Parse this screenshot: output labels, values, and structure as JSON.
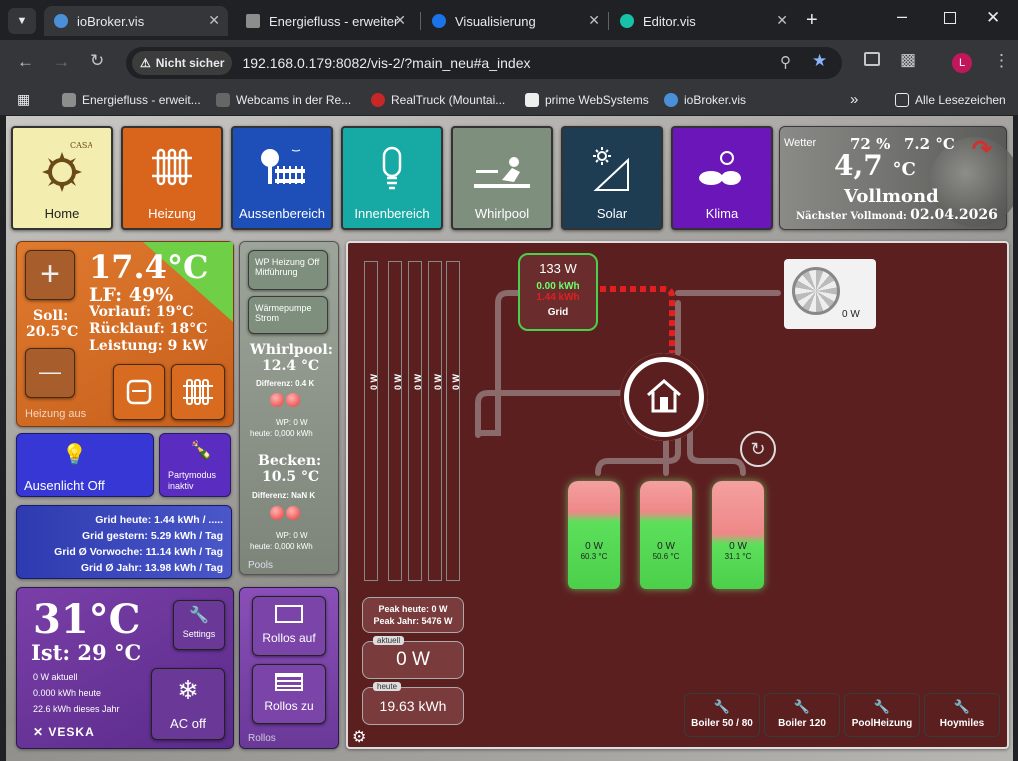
{
  "browser": {
    "tabs": [
      {
        "title": "ioBroker.vis",
        "active": true,
        "icon_color": "#4a90d9"
      },
      {
        "title": "Energiefluss - erweiter",
        "active": false,
        "icon_color": "#8d8d8d"
      },
      {
        "title": "Visualisierung",
        "active": false,
        "icon_color": "#1a73e8"
      },
      {
        "title": "Editor.vis",
        "active": false,
        "icon_color": "#18c2a8"
      }
    ],
    "security_label": "Nicht sicher",
    "url": "192.168.0.179:8082/vis-2/?main_neu#a_index",
    "profile_initial": "L",
    "bookmarks": [
      "Energiefluss - erweit...",
      "Webcams in der Re...",
      "RealTruck (Mountai...",
      "prime WebSystems",
      "ioBroker.vis"
    ],
    "all_bookmarks": "Alle Lesezeichen"
  },
  "nav": {
    "tiles": [
      {
        "label": "Home",
        "color": "#f3eeb0",
        "text_color": "#222",
        "icon": "sun-logo-icon"
      },
      {
        "label": "Heizung",
        "color": "#d9641c",
        "text_color": "#fff",
        "icon": "radiator-icon"
      },
      {
        "label": "Aussenbereich",
        "color": "#1e4fb8",
        "text_color": "#fff",
        "icon": "garden-icon"
      },
      {
        "label": "Innenbereich",
        "color": "#17a9a4",
        "text_color": "#fff",
        "icon": "bulb-icon"
      },
      {
        "label": "Whirlpool",
        "color": "#7f8f7d",
        "text_color": "#fff",
        "icon": "whirlpool-icon"
      },
      {
        "label": "Solar",
        "color": "#1e3d52",
        "text_color": "#fff",
        "icon": "solar-icon"
      },
      {
        "label": "Klima",
        "color": "#6a16b8",
        "text_color": "#fff",
        "icon": "climate-icon"
      }
    ],
    "logo_text": "CASA SOL"
  },
  "weather": {
    "label": "Wetter",
    "humidity": "72 %",
    "temp_small": "7.2 °C",
    "temp_big": "4,7",
    "temp_unit": "°C",
    "moon": "Vollmond",
    "next_full_moon_label": "Nächster Vollmond:",
    "next_full_moon_date": "02.04.2026"
  },
  "heating": {
    "temp": "17.4°C",
    "lf": "LF: 49%",
    "vorlauf": "Vorlauf: 19°C",
    "ruecklauf": "Rücklauf: 18°C",
    "leistung": "Leistung: 9 kW",
    "soll_label": "Soll:",
    "soll_value": "20.5°C",
    "status": "Heizung aus",
    "plus": "+",
    "minus": "—"
  },
  "outdoor_light": {
    "label": "Ausenlicht Off"
  },
  "party": {
    "label": "Partymodus inaktiv"
  },
  "grid_stats": [
    "Grid heute: 1.44 kWh / .....",
    "Grid gestern: 5.29 kWh / Tag",
    "Grid Ø Vorwoche: 11.14 kWh / Tag",
    "Grid Ø Jahr: 13.98 kWh / Tag"
  ],
  "ac": {
    "set_temp": "31°C",
    "ist": "Ist: 29 °C",
    "lines": [
      "0 W aktuell",
      "0.000 kWh heute",
      "22.6 kWh dieses Jahr"
    ],
    "brand": "VESKA",
    "settings_label": "Settings",
    "ac_off_label": "AC off"
  },
  "pools": {
    "wp_heizung": "WP Heizung Off Mitführung",
    "waermepumpe": "Wärmepumpe Strom",
    "whirlpool_title": "Whirlpool:",
    "whirlpool_temp": "12.4 °C",
    "whirlpool_diff": "Differenz: 0.4 K",
    "whirlpool_wp": "WP: 0 W",
    "whirlpool_today": "heute: 0,000 kWh",
    "becken_title": "Becken:",
    "becken_temp": "10.5 °C",
    "becken_diff": "Differenz: NaN K",
    "becken_wp": "WP: 0 W",
    "becken_today": "heute: 0,000 kWh",
    "footer": "Pools"
  },
  "rollos": {
    "up": "Rollos auf",
    "down": "Rollos zu",
    "footer": "Rollos"
  },
  "energy": {
    "grid_power": "133 W",
    "grid_export": "0.00 kWh",
    "grid_import": "1.44 kWh",
    "grid_label": "Grid",
    "ac_unit_power": "0 W",
    "vbars": [
      "0 W",
      "0 W",
      "0 W",
      "0 W",
      "0 W"
    ],
    "tanks": [
      {
        "power": "0 W",
        "temp": "60.3 °C",
        "fill": 0.62
      },
      {
        "power": "0 W",
        "temp": "50.6 °C",
        "fill": 0.62
      },
      {
        "power": "0 W",
        "temp": "31.1 °C",
        "fill": 0.42
      }
    ],
    "peak_today": "Peak heute: 0 W",
    "peak_year": "Peak Jahr: 5476 W",
    "current_tag": "aktuell",
    "current_value": "0 W",
    "today_tag": "heute",
    "today_value": "19.63 kWh",
    "buttons": [
      "Boiler 50 / 80",
      "Boiler 120",
      "PoolHeizung",
      "Hoymiles"
    ]
  }
}
